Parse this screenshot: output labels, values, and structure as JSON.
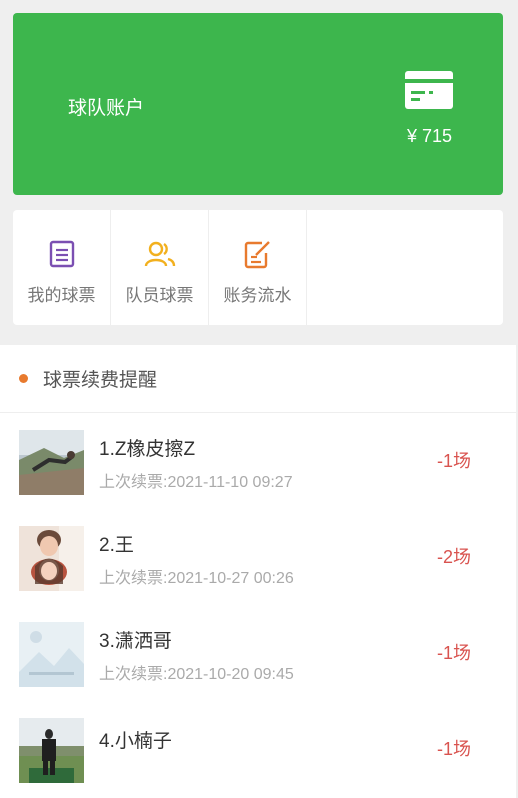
{
  "account": {
    "title": "球队账户",
    "balance": "¥ 715",
    "card_icon": "credit-card-icon"
  },
  "menu": [
    {
      "label": "我的球票",
      "icon": "ticket-list-icon",
      "color": "#7b4fb2"
    },
    {
      "label": "队员球票",
      "icon": "users-icon",
      "color": "#f2b01e"
    },
    {
      "label": "账务流水",
      "icon": "edit-note-icon",
      "color": "#e87a2e"
    }
  ],
  "reminder": {
    "title": "球票续费提醒",
    "dot_color": "#e87a2e",
    "items": [
      {
        "name": "1.Z橡皮擦Z",
        "renew": "上次续票:2021-11-10 09:27",
        "count": "-1场"
      },
      {
        "name": "2.王",
        "renew": "上次续票:2021-10-27 00:26",
        "count": "-2场"
      },
      {
        "name": "3.潇洒哥",
        "renew": "上次续票:2021-10-20 09:45",
        "count": "-1场"
      },
      {
        "name": "4.小楠子",
        "renew": "",
        "count": "-1场"
      }
    ]
  },
  "colors": {
    "accent": "#3db64d",
    "negative": "#d9534f"
  }
}
